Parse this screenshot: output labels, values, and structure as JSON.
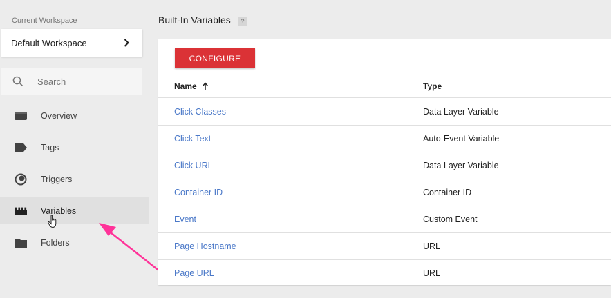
{
  "sidebar": {
    "workspace_label": "Current Workspace",
    "workspace_name": "Default Workspace",
    "search_placeholder": "Search",
    "items": [
      {
        "label": "Overview",
        "icon": "overview-icon"
      },
      {
        "label": "Tags",
        "icon": "tag-icon"
      },
      {
        "label": "Triggers",
        "icon": "trigger-icon"
      },
      {
        "label": "Variables",
        "icon": "variables-icon",
        "active": true
      },
      {
        "label": "Folders",
        "icon": "folder-icon"
      }
    ]
  },
  "main": {
    "title": "Built-In Variables",
    "help": "?",
    "configure_label": "CONFIGURE",
    "columns": {
      "name": "Name",
      "type": "Type"
    },
    "rows": [
      {
        "name": "Click Classes",
        "type": "Data Layer Variable"
      },
      {
        "name": "Click Text",
        "type": "Auto-Event Variable"
      },
      {
        "name": "Click URL",
        "type": "Data Layer Variable"
      },
      {
        "name": "Container ID",
        "type": "Container ID"
      },
      {
        "name": "Event",
        "type": "Custom Event"
      },
      {
        "name": "Page Hostname",
        "type": "URL"
      },
      {
        "name": "Page URL",
        "type": "URL"
      }
    ]
  },
  "colors": {
    "accent_red": "#db3236",
    "link_blue": "#4a78c8",
    "annotation_arrow": "#ff3399"
  }
}
